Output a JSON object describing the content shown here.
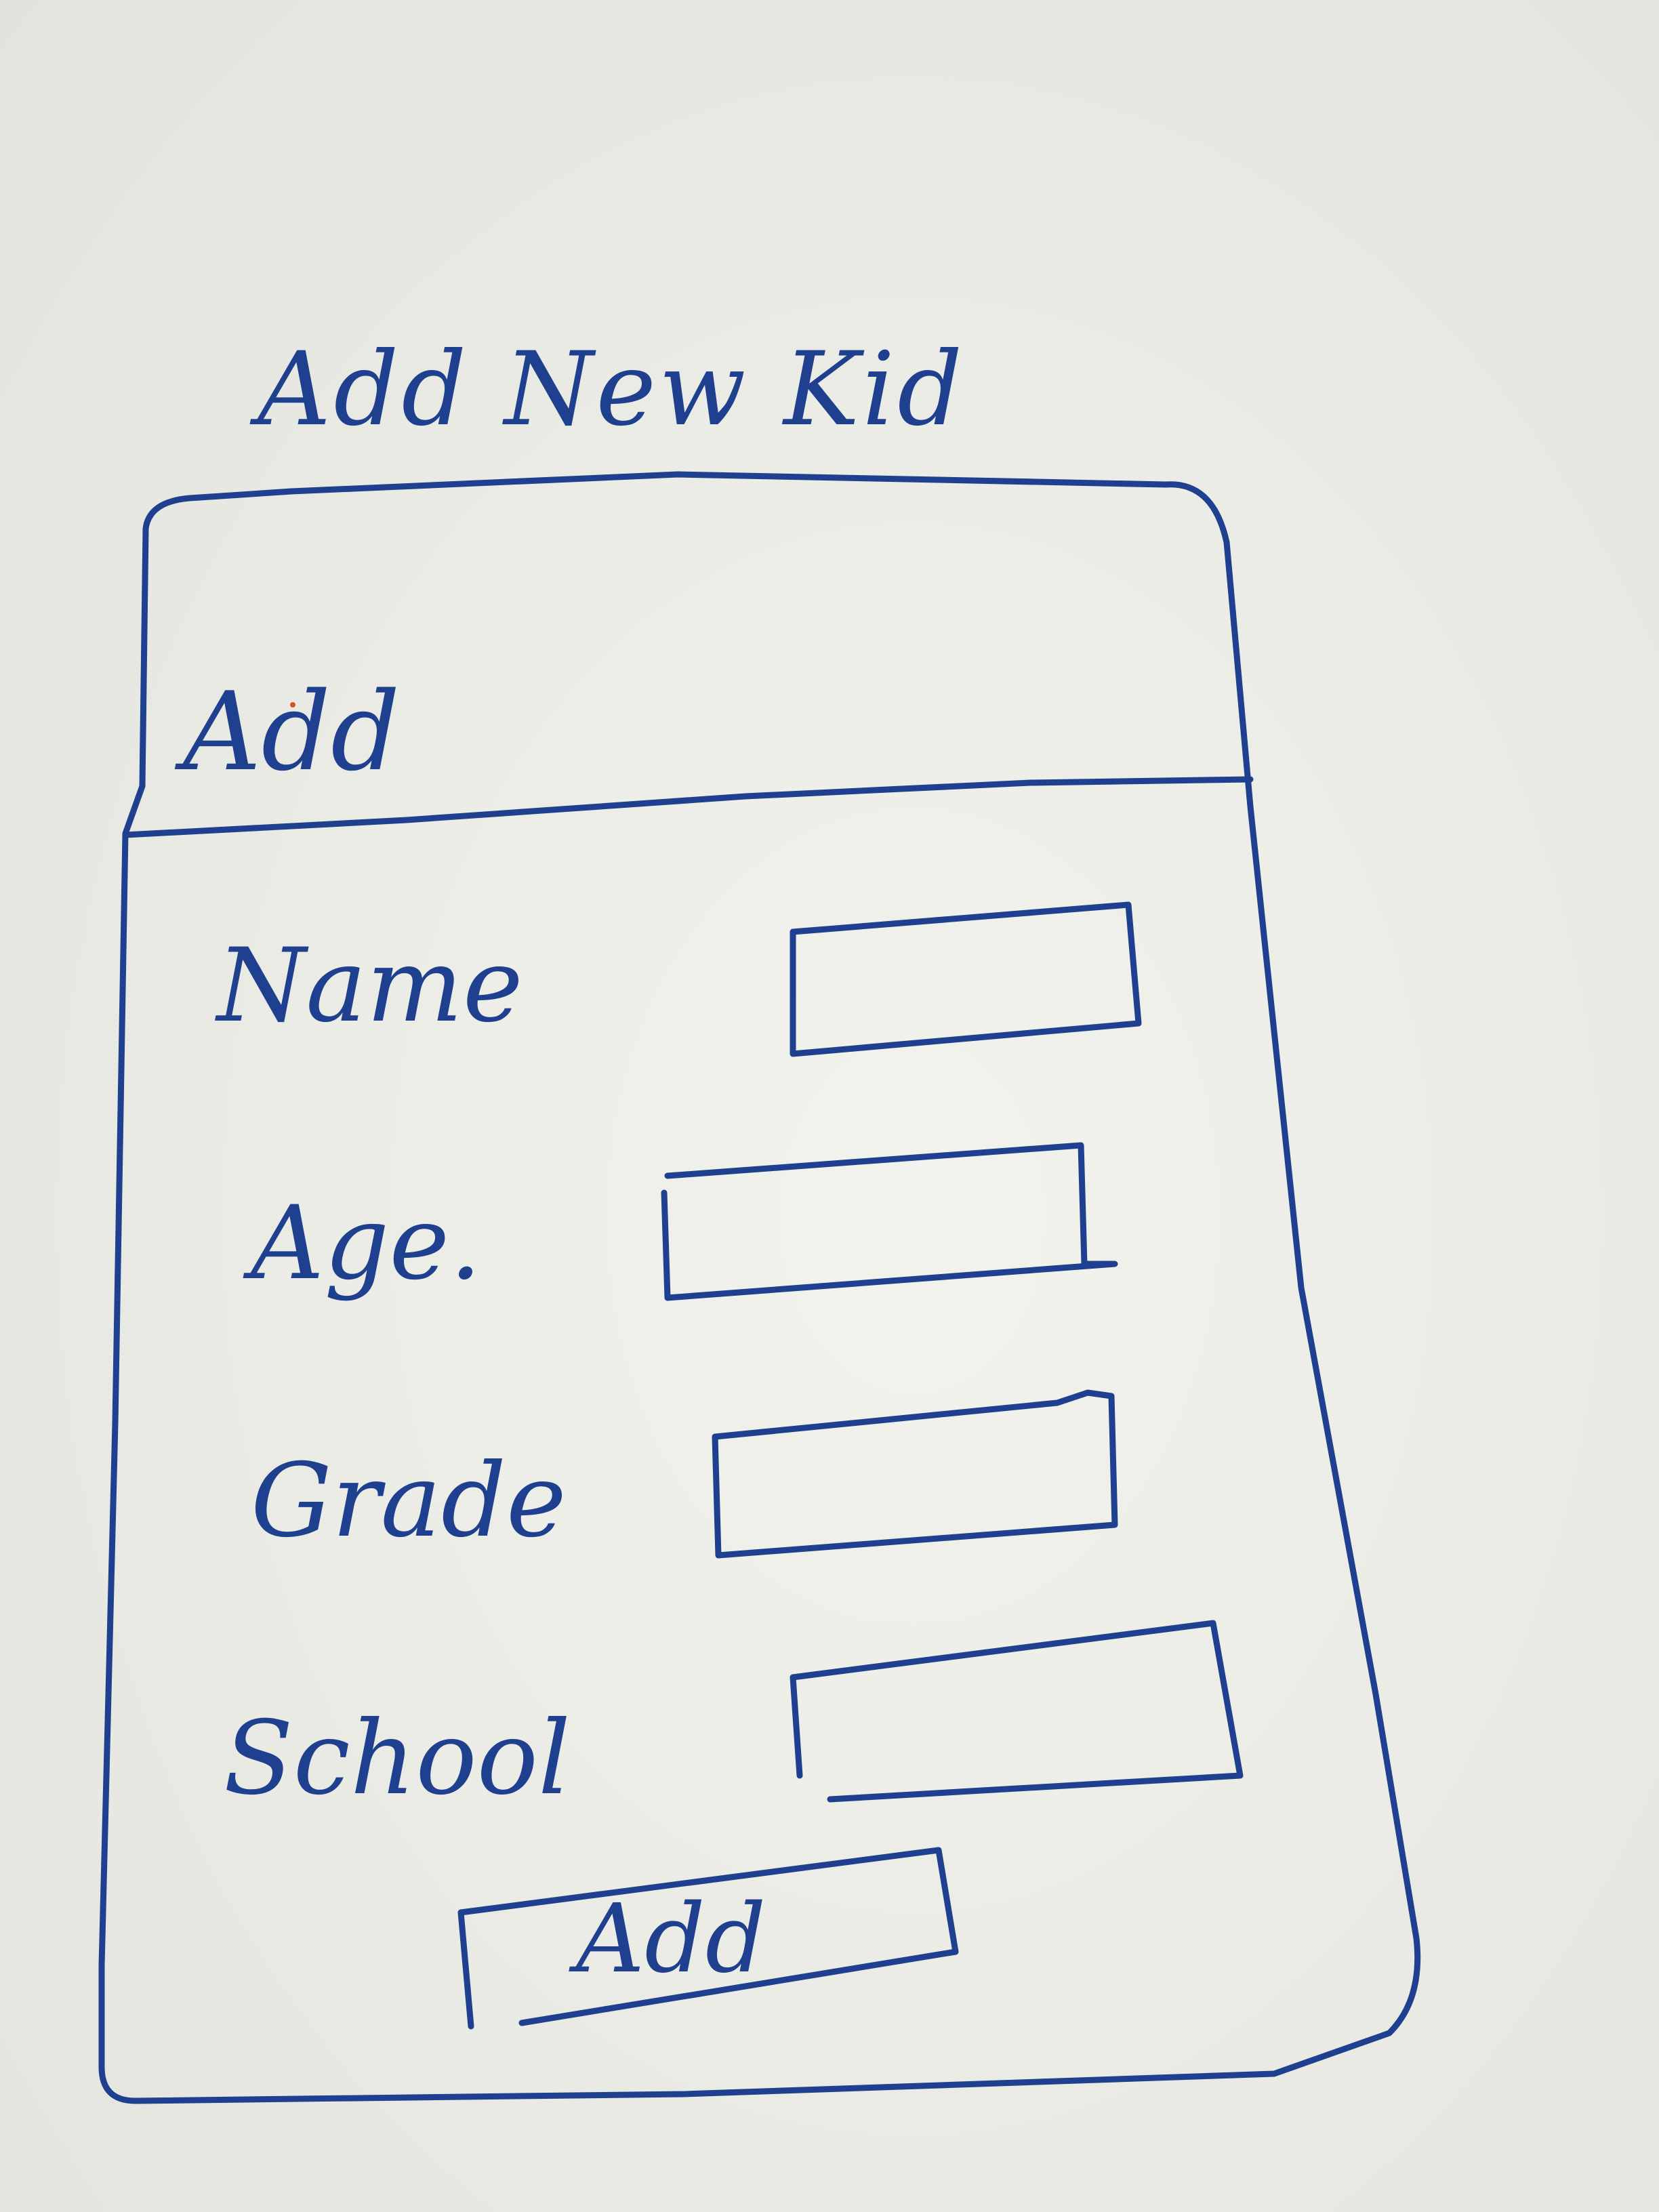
{
  "page": {
    "title": "Add New Kid"
  },
  "panel": {
    "header_label": "Add"
  },
  "form": {
    "fields": [
      {
        "label": "Name",
        "value": ""
      },
      {
        "label": "Age.",
        "value": ""
      },
      {
        "label": "Grade",
        "value": ""
      },
      {
        "label": "School",
        "value": ""
      }
    ],
    "submit_label": "Add"
  },
  "colors": {
    "ink": "#1f3f8f",
    "paper": "#ecece6"
  }
}
